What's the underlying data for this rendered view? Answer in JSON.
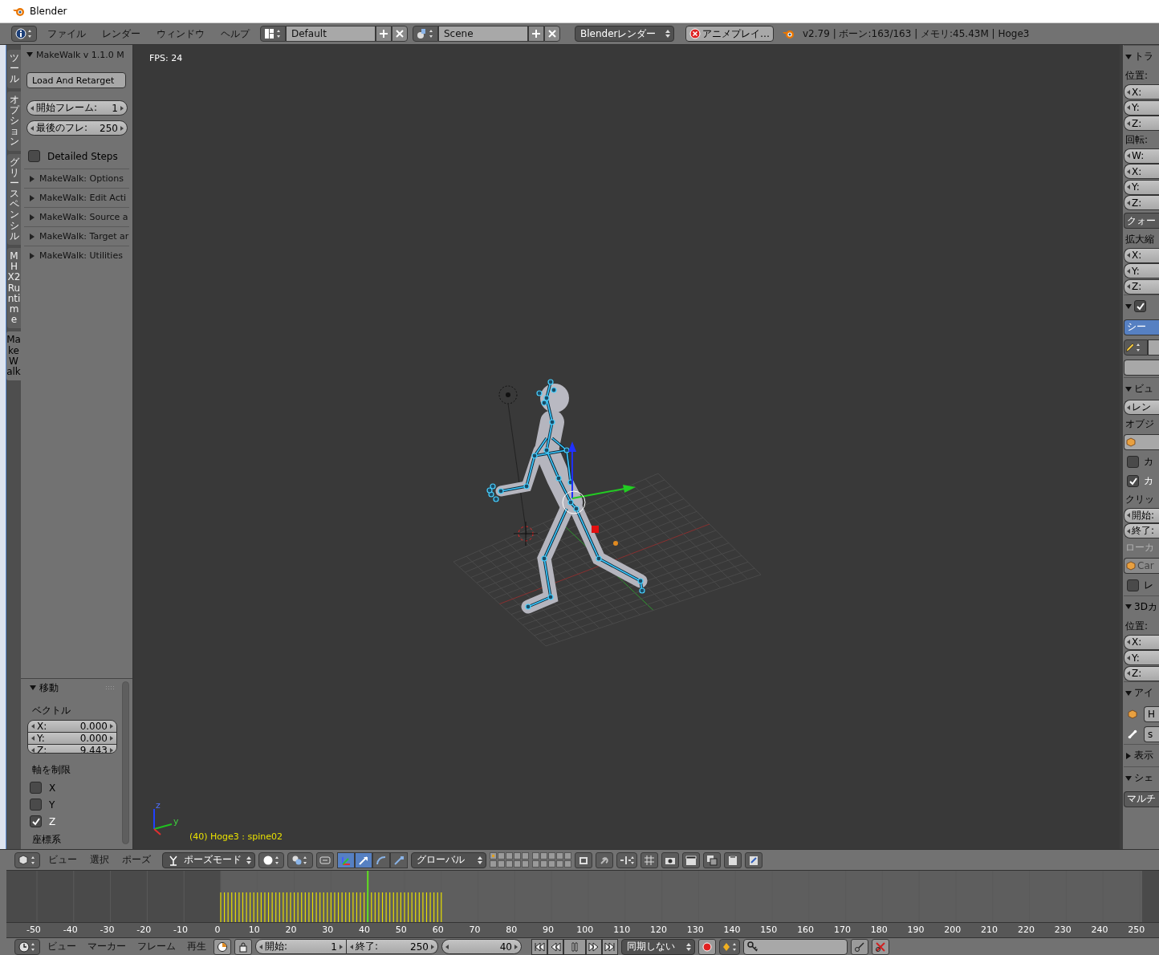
{
  "window": {
    "title": "Blender"
  },
  "info_header": {
    "menus": [
      "ファイル",
      "レンダー",
      "ウィンドウ",
      "ヘルプ"
    ],
    "layout": "Default",
    "scene": "Scene",
    "render_engine": "Blenderレンダー",
    "job": "アニメプレイ…",
    "stats": "v2.79 | ボーン:163/163  | メモリ:45.43M | Hoge3"
  },
  "tool_tabs": [
    {
      "label": "ツール",
      "selected": false
    },
    {
      "label": "オプション",
      "selected": false
    },
    {
      "label": "グリースペンシル",
      "selected": false
    },
    {
      "label": "MHX2 Runtime",
      "selected": false
    },
    {
      "label": "MakeWalk",
      "selected": true
    }
  ],
  "makewalk_panel": {
    "title": "MakeWalk v 1.1.0 M",
    "expanded": true,
    "load_button": "Load And Retarget",
    "fields": [
      {
        "label": "開始フレーム:",
        "value": "1"
      },
      {
        "label": "最後のフレ:",
        "value": "250"
      }
    ],
    "detailed_steps": {
      "label": "Detailed Steps",
      "checked": false
    },
    "subpanels": [
      {
        "title": "MakeWalk: Options",
        "expanded": false
      },
      {
        "title": "MakeWalk: Edit Acti",
        "expanded": false
      },
      {
        "title": "MakeWalk: Source a",
        "expanded": false
      },
      {
        "title": "MakeWalk: Target ar",
        "expanded": false
      },
      {
        "title": "MakeWalk: Utilities",
        "expanded": false
      }
    ]
  },
  "operator_panel": {
    "title": "移動",
    "expanded": true,
    "vector_label": "ベクトル",
    "vector": [
      {
        "axis": "X:",
        "value": "0.000"
      },
      {
        "axis": "Y:",
        "value": "0.000"
      },
      {
        "axis": "Z:",
        "value": "9.443"
      }
    ],
    "constraint_label": "軸を制限",
    "constraint_axes": [
      {
        "label": "X",
        "checked": false
      },
      {
        "label": "Y",
        "checked": false
      },
      {
        "label": "Z",
        "checked": true
      }
    ],
    "orientation_label": "座標系"
  },
  "viewport": {
    "fps": "FPS: 24",
    "gizmo_labels": [
      "z",
      "y"
    ],
    "object_info": "(40) Hoge3 : spine02"
  },
  "properties_panel": {
    "rows": [
      {
        "kind": "header",
        "label": "トラ",
        "expanded": true
      },
      {
        "kind": "label",
        "label": "位置:",
        "disabled": false
      },
      {
        "kind": "field",
        "label": "X:"
      },
      {
        "kind": "field",
        "label": "Y:"
      },
      {
        "kind": "field",
        "label": "Z:"
      },
      {
        "kind": "label",
        "label": "回転:",
        "disabled": false
      },
      {
        "kind": "field",
        "label": "W:"
      },
      {
        "kind": "field",
        "label": "X:"
      },
      {
        "kind": "field",
        "label": "Y:"
      },
      {
        "kind": "field",
        "label": "Z:"
      },
      {
        "kind": "button",
        "label": "クォー",
        "selected": false
      },
      {
        "kind": "label",
        "label": "拡大縮",
        "disabled": false
      },
      {
        "kind": "field",
        "label": "X:"
      },
      {
        "kind": "field",
        "label": "Y:"
      },
      {
        "kind": "field",
        "label": "Z:"
      },
      {
        "kind": "check_header",
        "checked": true,
        "expanded": true
      },
      {
        "kind": "button",
        "label": "シー",
        "selected": true
      },
      {
        "kind": "pencil"
      },
      {
        "kind": "blank"
      },
      {
        "kind": "header",
        "label": "ビュ",
        "expanded": true
      },
      {
        "kind": "field",
        "label": "レン"
      },
      {
        "kind": "label",
        "label": "オブジ",
        "disabled": false
      },
      {
        "kind": "object",
        "disabled": false
      },
      {
        "kind": "checkbox",
        "label": "カ",
        "checked": false
      },
      {
        "kind": "checkbox",
        "label": "カ",
        "checked": true
      },
      {
        "kind": "label",
        "label": "クリッ",
        "disabled": false
      },
      {
        "kind": "field",
        "label": "開始:"
      },
      {
        "kind": "field",
        "label": "終了:"
      },
      {
        "kind": "label",
        "label": "ローカ",
        "disabled": true
      },
      {
        "kind": "object",
        "label": "Car",
        "disabled": true
      },
      {
        "kind": "checkbox",
        "label": "レ",
        "checked": false
      },
      {
        "kind": "header",
        "label": "3Dカ",
        "expanded": true
      },
      {
        "kind": "label",
        "label": "位置:",
        "disabled": false
      },
      {
        "kind": "field",
        "label": "X:"
      },
      {
        "kind": "field",
        "label": "Y:"
      },
      {
        "kind": "field",
        "label": "Z:"
      },
      {
        "kind": "header",
        "label": "アイ",
        "expanded": true
      },
      {
        "kind": "object_name",
        "label": "H"
      },
      {
        "kind": "bone_name",
        "label": "s"
      },
      {
        "kind": "header",
        "label": "表示",
        "expanded": false
      },
      {
        "kind": "header",
        "label": "シェ",
        "expanded": true
      },
      {
        "kind": "button",
        "label": "マルチ",
        "selected": false
      }
    ]
  },
  "view3d_header": {
    "menus": [
      "ビュー",
      "選択",
      "ポーズ"
    ],
    "mode": "ポーズモード",
    "manipulators": [
      {
        "selected": true
      },
      {
        "selected": true
      },
      {
        "selected": false
      },
      {
        "selected": false
      }
    ],
    "orientation": "グローバル",
    "layers": [
      {
        "selected": true
      },
      {
        "selected": false
      },
      {
        "selected": false
      },
      {
        "selected": false
      },
      {
        "selected": false
      },
      {
        "selected": false
      },
      {
        "selected": false
      },
      {
        "selected": false
      },
      {
        "selected": false
      },
      {
        "selected": false
      },
      {
        "selected": false
      },
      {
        "selected": false
      },
      {
        "selected": false
      },
      {
        "selected": false
      },
      {
        "selected": false
      },
      {
        "selected": false
      },
      {
        "selected": false
      },
      {
        "selected": false
      },
      {
        "selected": false
      },
      {
        "selected": false
      }
    ]
  },
  "timeline": {
    "ruler": [
      "-50",
      "-40",
      "-30",
      "-20",
      "-10",
      "0",
      "10",
      "20",
      "30",
      "40",
      "50",
      "60",
      "70",
      "80",
      "90",
      "100",
      "110",
      "120",
      "130",
      "140",
      "150",
      "160",
      "170",
      "180",
      "190",
      "200",
      "210",
      "220",
      "230",
      "240",
      "250"
    ]
  },
  "timeline_header": {
    "menus": [
      "ビュー",
      "マーカー",
      "フレーム",
      "再生"
    ],
    "start": {
      "label": "開始:",
      "value": "1"
    },
    "end": {
      "label": "終了:",
      "value": "250"
    },
    "current_frame": "40",
    "sync": "同期しない"
  }
}
